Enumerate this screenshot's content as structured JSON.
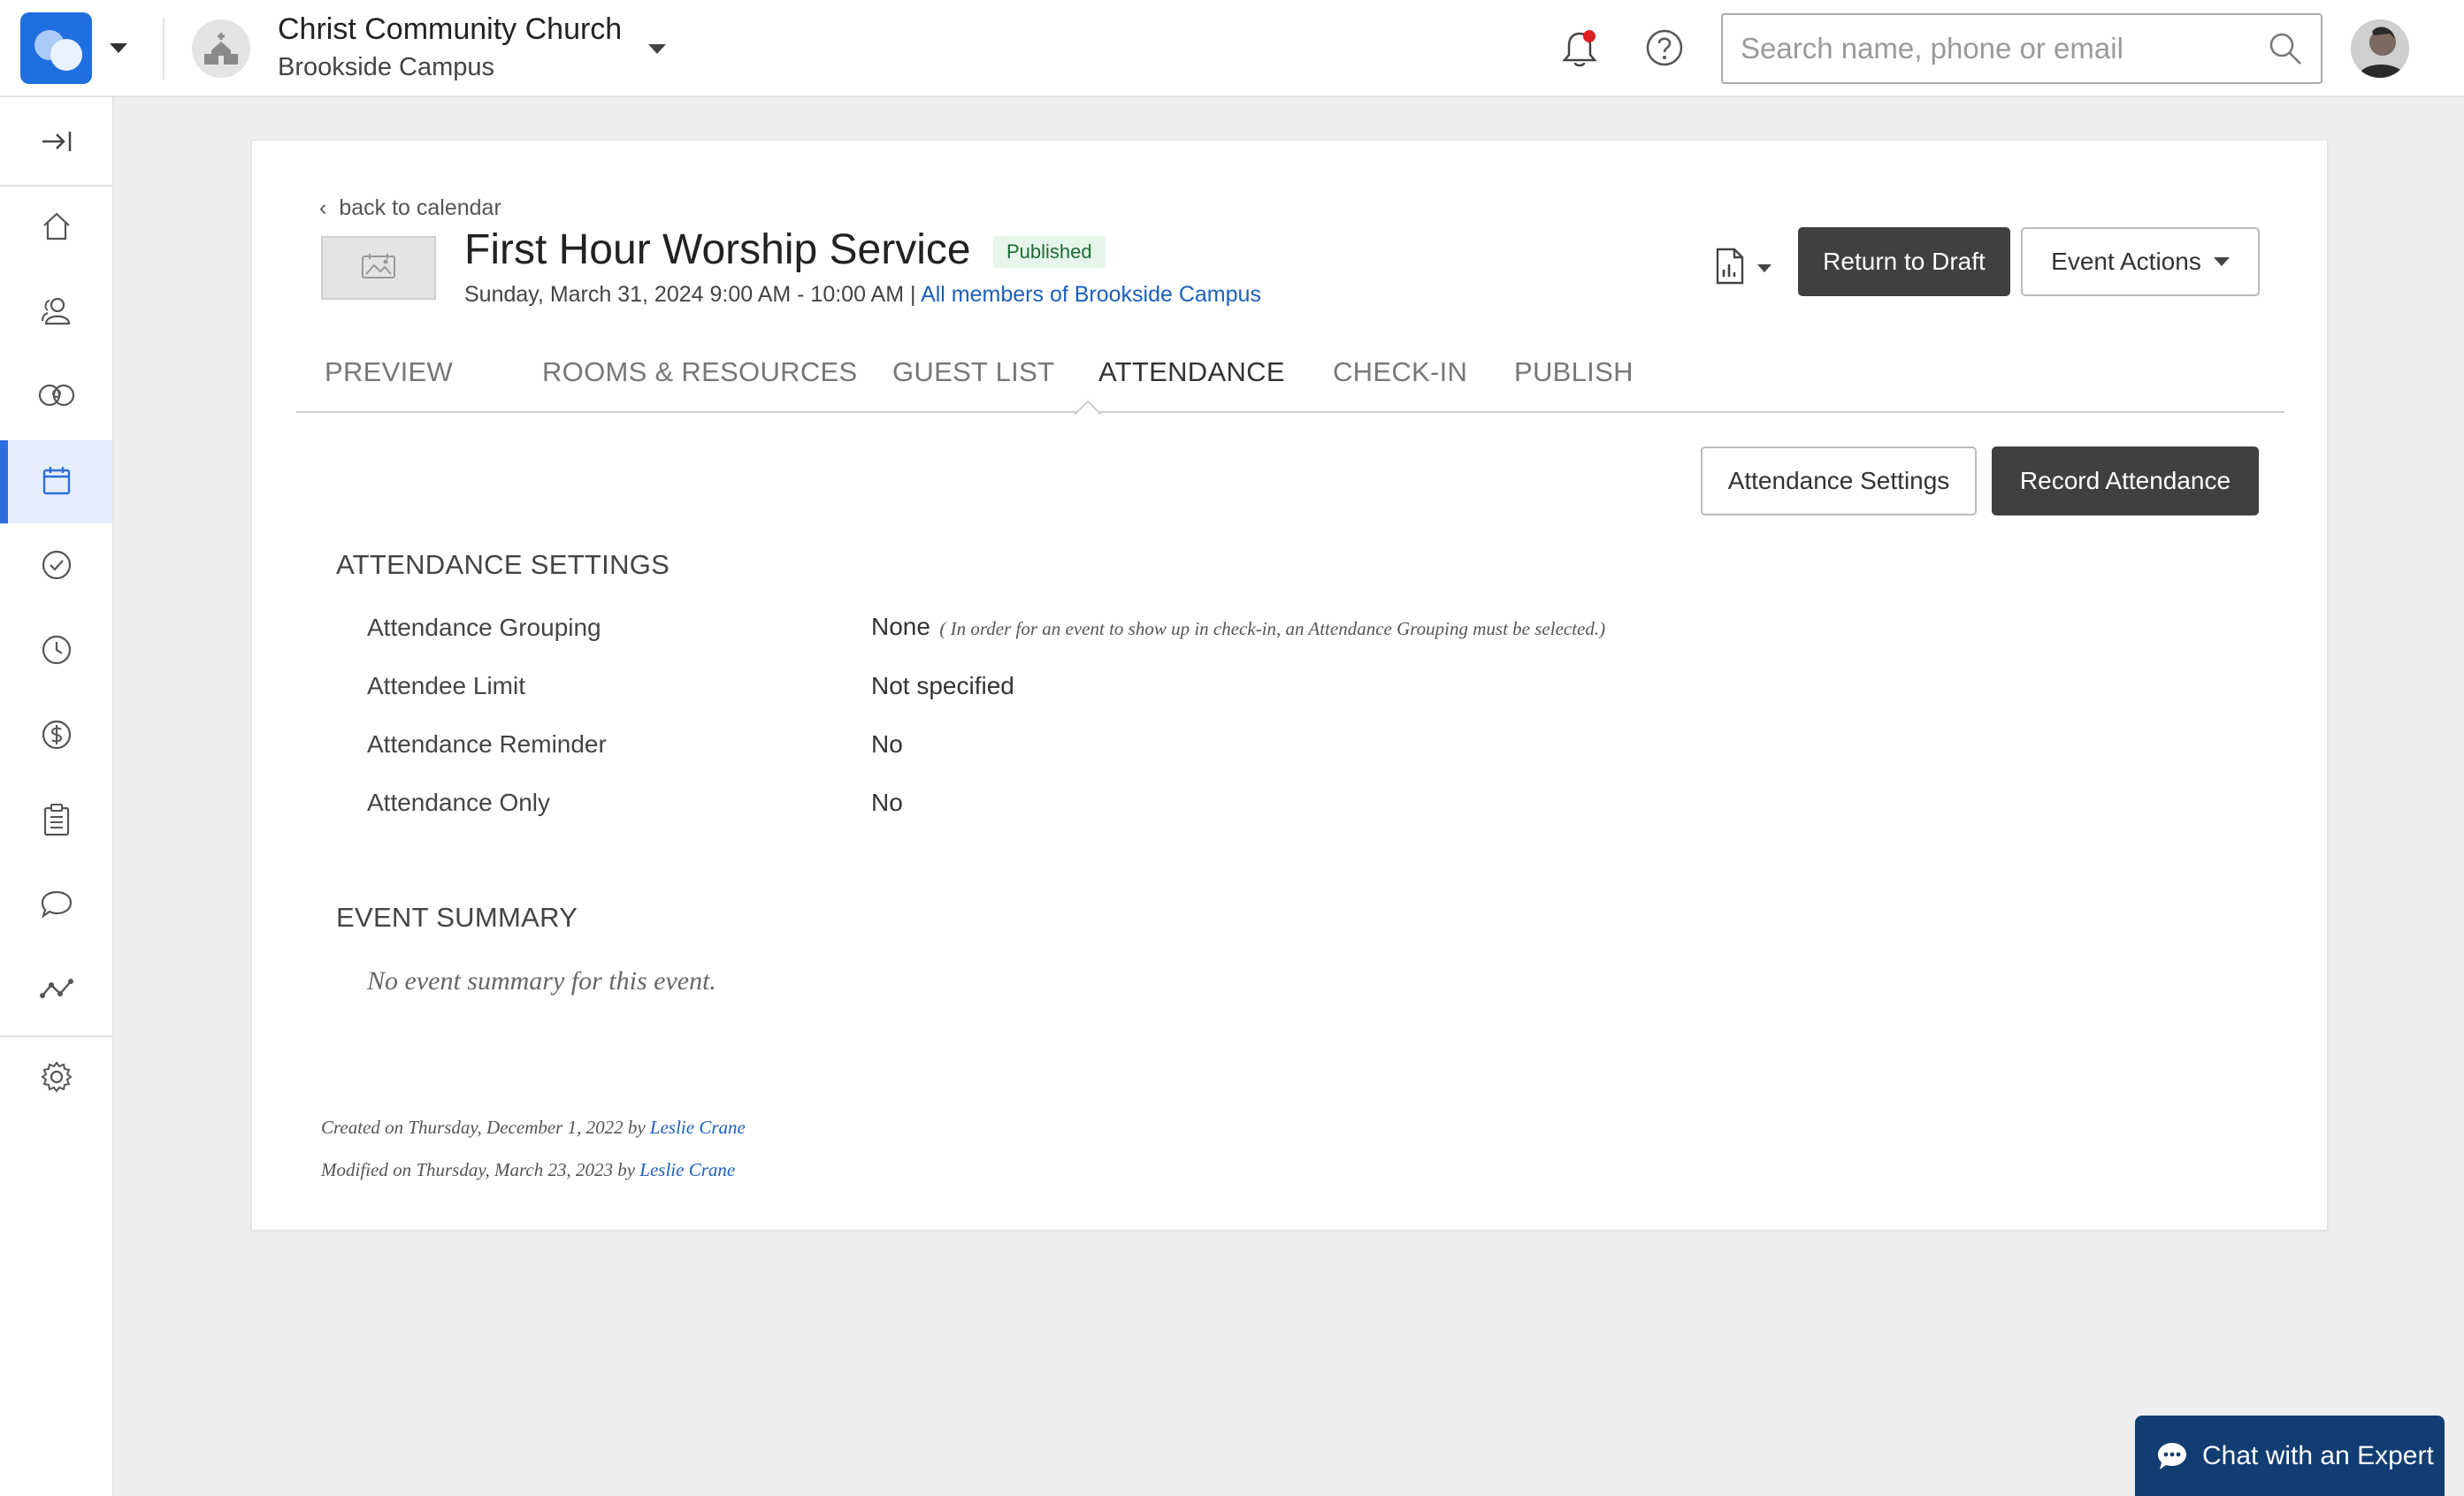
{
  "header": {
    "org_name": "Christ Community Church",
    "campus": "Brookside Campus",
    "search_placeholder": "Search name, phone or email"
  },
  "event": {
    "back_label": "back to calendar",
    "title": "First Hour Worship Service",
    "status": "Published",
    "date_range": "Sunday, March 31, 2024 9:00 AM - 10:00 AM",
    "date_separator": " | ",
    "audience": "All members of Brookside Campus",
    "return_to_draft": "Return to Draft",
    "event_actions": "Event Actions"
  },
  "tabs": [
    {
      "label": "PREVIEW"
    },
    {
      "label": "ROOMS & RESOURCES"
    },
    {
      "label": "GUEST LIST"
    },
    {
      "label": "ATTENDANCE"
    },
    {
      "label": "CHECK-IN"
    },
    {
      "label": "PUBLISH"
    }
  ],
  "active_tab": "ATTENDANCE",
  "attendance_actions": {
    "settings_button": "Attendance Settings",
    "record_button": "Record Attendance"
  },
  "attendance_settings": {
    "title": "ATTENDANCE SETTINGS",
    "rows": [
      {
        "label": "Attendance Grouping",
        "value": "None",
        "note": "( In order for an event to show up in check-in, an Attendance Grouping must be selected.)"
      },
      {
        "label": "Attendee Limit",
        "value": "Not specified"
      },
      {
        "label": "Attendance Reminder",
        "value": "No"
      },
      {
        "label": "Attendance Only",
        "value": "No"
      }
    ]
  },
  "event_summary": {
    "title": "EVENT SUMMARY",
    "empty_text": "No event summary for this event."
  },
  "meta": {
    "created_text": "Created on Thursday, December 1, 2022 by ",
    "created_by": "Leslie Crane",
    "modified_text": "Modified on Thursday, March 23, 2023 by ",
    "modified_by": "Leslie Crane"
  },
  "chat": {
    "label": "Chat with an Expert"
  },
  "colors": {
    "brand_blue": "#1f6fe0",
    "link": "#1a5fbf",
    "dark_button": "#404040",
    "chat_bg": "#113d73",
    "published_bg": "#e6f6ea",
    "notification_dot": "#e02020"
  },
  "sidebar_icons": [
    "collapse-icon",
    "home-icon",
    "people-icon",
    "groups-icon",
    "calendar-icon",
    "check-circle-icon",
    "clock-icon",
    "dollar-icon",
    "clipboard-icon",
    "chat-bubbles-icon",
    "analytics-icon",
    "gear-icon"
  ]
}
